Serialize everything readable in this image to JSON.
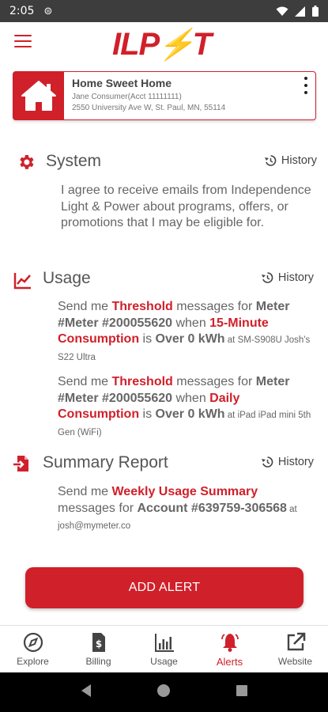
{
  "status_bar": {
    "time": "2:05"
  },
  "header": {
    "logo_text_left": "ILP",
    "logo_bolt": "⚡",
    "logo_text_right": "T"
  },
  "account": {
    "name": "Home Sweet Home",
    "holder": "Jane Consumer(Acct 11111111)",
    "address": "2550 University Ave W, St. Paul, MN, 55114"
  },
  "system": {
    "title": "System",
    "history_label": "History",
    "text": "I agree to receive emails from Independence Light & Power about programs, offers, or promotions that I may be eligible for."
  },
  "usage": {
    "title": "Usage",
    "history_label": "History",
    "alerts": [
      {
        "p1": "Send me ",
        "type": "Threshold",
        "p2": " messages for ",
        "meter": "Meter #Meter #200055620",
        "p3": " when ",
        "interval": "15-Minute Consumption",
        "p4": " is ",
        "condition": "Over 0 kWh",
        "p5": " at ",
        "device": "SM-S908U Josh's S22 Ultra"
      },
      {
        "p1": "Send me ",
        "type": "Threshold",
        "p2": " messages for ",
        "meter": "Meter #Meter #200055620",
        "p3": " when ",
        "interval": "Daily Consumption",
        "p4": " is ",
        "condition": "Over 0 kWh",
        "p5": " at ",
        "device": "iPad iPad mini 5th Gen (WiFi)"
      }
    ]
  },
  "summary": {
    "title": "Summary Report",
    "history_label": "History",
    "p1": "Send me ",
    "type": "Weekly Usage Summary",
    "p2": " messages for ",
    "account": "Account #639759-306568",
    "p3": " at ",
    "email": "josh@mymeter.co"
  },
  "add_alert_label": "ADD ALERT",
  "nav": [
    {
      "label": "Explore",
      "icon": "compass-icon"
    },
    {
      "label": "Billing",
      "icon": "bill-icon"
    },
    {
      "label": "Usage",
      "icon": "bar-chart-icon"
    },
    {
      "label": "Alerts",
      "icon": "bell-icon"
    },
    {
      "label": "Website",
      "icon": "external-link-icon"
    }
  ],
  "colors": {
    "accent": "#D0202A",
    "bolt": "#F5B800"
  }
}
